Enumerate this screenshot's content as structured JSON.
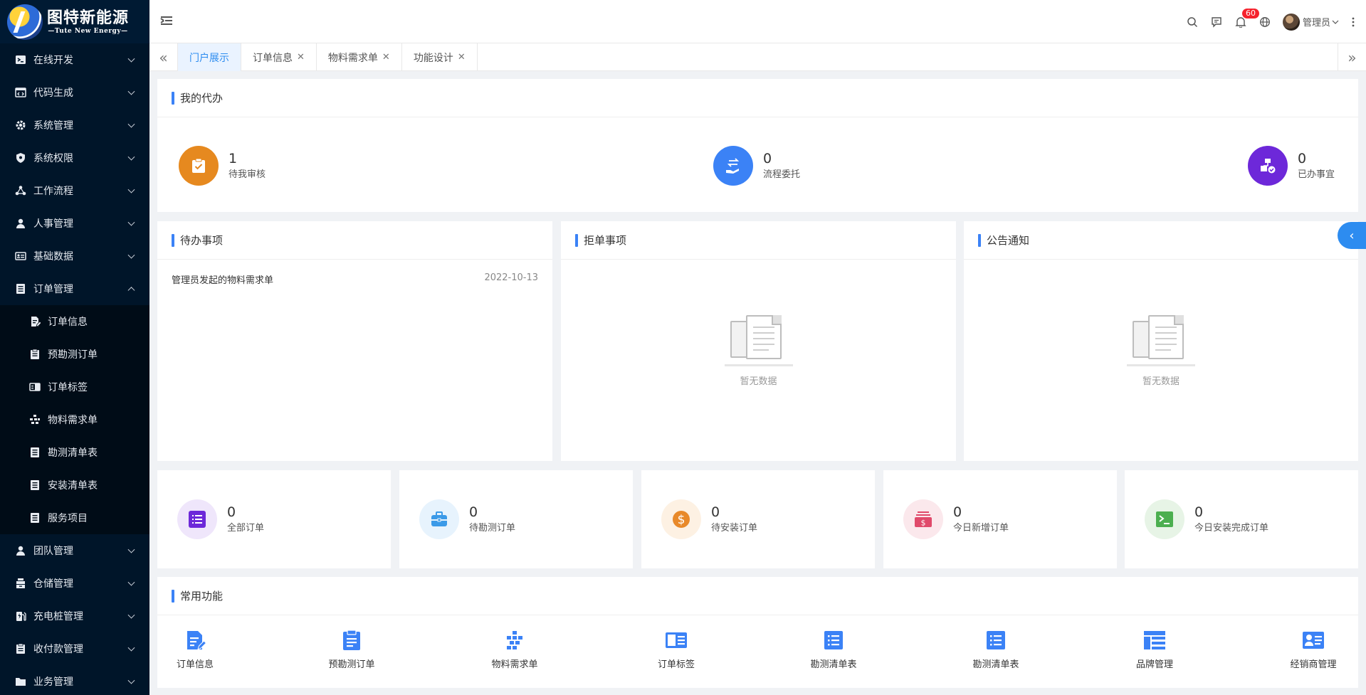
{
  "brand": {
    "name": "图特新能源",
    "tagline": "—Tute New Energy—"
  },
  "sidebar": {
    "items": [
      {
        "label": "在线开发",
        "icon": "terminal-icon"
      },
      {
        "label": "代码生成",
        "icon": "code-icon"
      },
      {
        "label": "系统管理",
        "icon": "gear-icon"
      },
      {
        "label": "系统权限",
        "icon": "shield-icon"
      },
      {
        "label": "工作流程",
        "icon": "workflow-icon"
      },
      {
        "label": "人事管理",
        "icon": "person-icon"
      },
      {
        "label": "基础数据",
        "icon": "id-card-icon"
      },
      {
        "label": "订单管理",
        "icon": "list-icon",
        "expanded": true
      }
    ],
    "order_sub": [
      {
        "label": "订单信息",
        "icon": "edit-doc-icon"
      },
      {
        "label": "预勘测订单",
        "icon": "clipboard-icon"
      },
      {
        "label": "订单标签",
        "icon": "tag-card-icon"
      },
      {
        "label": "物料需求单",
        "icon": "blocks-icon"
      },
      {
        "label": "勘测清单表",
        "icon": "list-icon"
      },
      {
        "label": "安装清单表",
        "icon": "list-icon"
      },
      {
        "label": "服务项目",
        "icon": "list-icon"
      }
    ],
    "items_after": [
      {
        "label": "团队管理",
        "icon": "person-icon"
      },
      {
        "label": "仓储管理",
        "icon": "warehouse-icon"
      },
      {
        "label": "充电桩管理",
        "icon": "charger-icon"
      },
      {
        "label": "收付款管理",
        "icon": "receipt-icon"
      },
      {
        "label": "业务管理",
        "icon": "folder-icon"
      }
    ]
  },
  "header": {
    "notification_count": "60",
    "user_name": "管理员"
  },
  "tabs": [
    {
      "label": "门户展示",
      "active": true
    },
    {
      "label": "订单信息"
    },
    {
      "label": "物料需求单"
    },
    {
      "label": "功能设计"
    }
  ],
  "my_tasks": {
    "title": "我的代办",
    "stats": [
      {
        "value": "1",
        "label": "待我审核",
        "color": "#e6891f"
      },
      {
        "value": "0",
        "label": "流程委托",
        "color": "#3b82f6"
      },
      {
        "value": "0",
        "label": "已办事宜",
        "color": "#6d28d9"
      }
    ]
  },
  "pending": {
    "title": "待办事项",
    "rows": [
      {
        "text": "管理员发起的物料需求单",
        "date": "2022-10-13"
      }
    ]
  },
  "rejected": {
    "title": "拒单事项",
    "empty_text": "暂无数据"
  },
  "notice": {
    "title": "公告通知",
    "empty_text": "暂无数据"
  },
  "order_stats": [
    {
      "value": "0",
      "label": "全部订单",
      "color": "#6d28d9",
      "bg": "#efe6fb"
    },
    {
      "value": "0",
      "label": "待勘测订单",
      "color": "#3b9ae8",
      "bg": "#e7f3fd"
    },
    {
      "value": "0",
      "label": "待安装订单",
      "color": "#e8892a",
      "bg": "#fdf1e3"
    },
    {
      "value": "0",
      "label": "今日新增订单",
      "color": "#e04a6b",
      "bg": "#fbe8ec"
    },
    {
      "value": "0",
      "label": "今日安装完成订单",
      "color": "#4caf50",
      "bg": "#e7f4e6"
    }
  ],
  "common": {
    "title": "常用功能",
    "items": [
      {
        "label": "订单信息"
      },
      {
        "label": "预勘测订单"
      },
      {
        "label": "物料需求单"
      },
      {
        "label": "订单标签"
      },
      {
        "label": "勘测清单表"
      },
      {
        "label": "勘测清单表"
      },
      {
        "label": "品牌管理"
      },
      {
        "label": "经销商管理"
      }
    ],
    "color": "#3b82f6"
  }
}
